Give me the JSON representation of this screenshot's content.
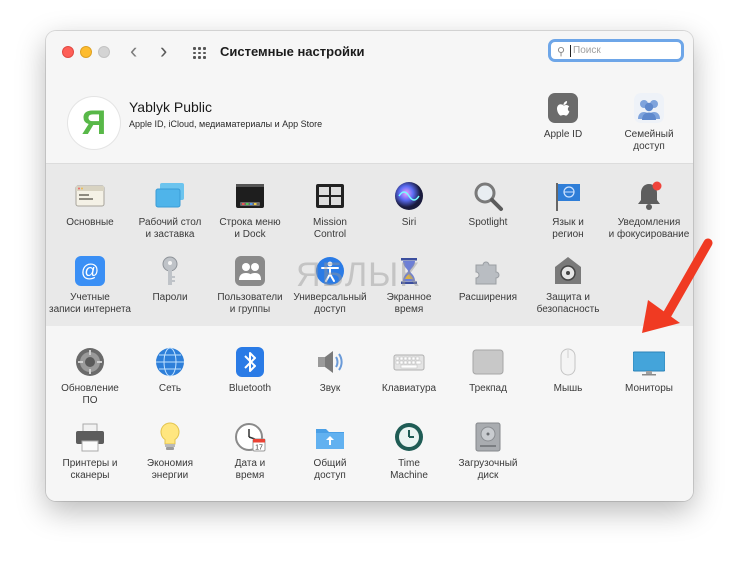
{
  "window": {
    "title": "Системные настройки",
    "nav_back": "‹",
    "nav_forward": "›",
    "search_placeholder": "Поиск"
  },
  "profile": {
    "avatar_letter": "Я",
    "name": "Yablyk Public",
    "subtitle": "Apple ID, iCloud, медиаматериалы и App Store",
    "items": [
      {
        "label": "Apple ID",
        "icon": "apple-icon"
      },
      {
        "label": "Семейный\nдоступ",
        "icon": "family-icon"
      }
    ]
  },
  "row1": [
    {
      "label": "Основные",
      "icon": "general-icon"
    },
    {
      "label": "Рабочий стол\nи заставка",
      "icon": "desktop-icon"
    },
    {
      "label": "Строка меню\nи Dock",
      "icon": "dock-icon"
    },
    {
      "label": "Mission\nControl",
      "icon": "mission-control-icon"
    },
    {
      "label": "Siri",
      "icon": "siri-icon"
    },
    {
      "label": "Spotlight",
      "icon": "spotlight-icon"
    },
    {
      "label": "Язык и\nрегион",
      "icon": "language-icon"
    },
    {
      "label": "Уведомления\nи фокусирование",
      "icon": "notifications-icon"
    }
  ],
  "row2": [
    {
      "label": "Учетные\nзаписи интернета",
      "icon": "internet-accounts-icon"
    },
    {
      "label": "Пароли",
      "icon": "key-icon"
    },
    {
      "label": "Пользователи\nи группы",
      "icon": "users-icon"
    },
    {
      "label": "Универсальный\nдоступ",
      "icon": "accessibility-icon"
    },
    {
      "label": "Экранное\nвремя",
      "icon": "hourglass-icon"
    },
    {
      "label": "Расширения",
      "icon": "puzzle-icon"
    },
    {
      "label": "Защита и\nбезопасность",
      "icon": "security-icon"
    }
  ],
  "row3": [
    {
      "label": "Обновление\nПО",
      "icon": "software-update-icon"
    },
    {
      "label": "Сеть",
      "icon": "network-icon"
    },
    {
      "label": "Bluetooth",
      "icon": "bluetooth-icon"
    },
    {
      "label": "Звук",
      "icon": "sound-icon"
    },
    {
      "label": "Клавиатура",
      "icon": "keyboard-icon"
    },
    {
      "label": "Трекпад",
      "icon": "trackpad-icon"
    },
    {
      "label": "Мышь",
      "icon": "mouse-icon"
    },
    {
      "label": "Мониторы",
      "icon": "display-icon"
    }
  ],
  "row4": [
    {
      "label": "Принтеры и\nсканеры",
      "icon": "printer-icon"
    },
    {
      "label": "Экономия\nэнергии",
      "icon": "bulb-icon"
    },
    {
      "label": "Дата и\nвремя",
      "icon": "clock-icon"
    },
    {
      "label": "Общий\nдоступ",
      "icon": "sharing-icon"
    },
    {
      "label": "Time\nMachine",
      "icon": "time-machine-icon"
    },
    {
      "label": "Загрузочный\nдиск",
      "icon": "startup-disk-icon"
    }
  ],
  "watermark": "ЯБЛЫК",
  "colors": {
    "accent": "#3a87f2",
    "arrow": "#f03a22",
    "avatar_letter": "#58b848"
  }
}
